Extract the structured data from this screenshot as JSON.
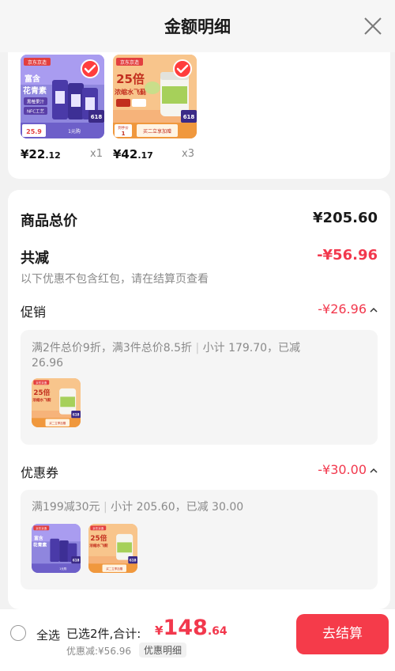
{
  "header": {
    "title": "金额明细"
  },
  "products": [
    {
      "price_int": "¥22",
      "price_dec": ".12",
      "qty": "x1",
      "texts": [
        "京东京造",
        "富含",
        "花青素",
        "黑莓果汁",
        "NFC工艺",
        "618",
        "25.9",
        "1元购"
      ]
    },
    {
      "price_int": "¥42",
      "price_dec": ".17",
      "qty": "x3",
      "texts": [
        "京东京造",
        "25倍",
        "浓缩水飞蓟",
        "618",
        "到手价",
        "1",
        "买二立享加赠"
      ]
    }
  ],
  "summary": {
    "total_label": "商品总价",
    "total_value": "¥205.60",
    "reduce_label": "共减",
    "reduce_value": "-¥56.96",
    "note": "以下优惠不包含红包，请在结算页查看",
    "promo_label": "促销",
    "promo_value": "-¥26.96",
    "promo_desc_a": "满2件总价9折，满3件总价8.5折",
    "promo_desc_b": "小计 179.70，已减",
    "promo_desc_c": "26.96",
    "coupon_label": "优惠券",
    "coupon_value": "-¥30.00",
    "coupon_desc_a": "满199减30元",
    "coupon_desc_b": "小计 205.60，已减 30.00"
  },
  "bottom": {
    "select_all": "全选",
    "selected": "已选2件,合计:",
    "total_cur": "¥",
    "total_int": "148",
    "total_dec": ".64",
    "saving": "优惠减:¥56.96",
    "detail": "优惠明细",
    "checkout": "去结算"
  },
  "colors": {
    "accent": "#f2384d",
    "button": "#f53b4a"
  }
}
